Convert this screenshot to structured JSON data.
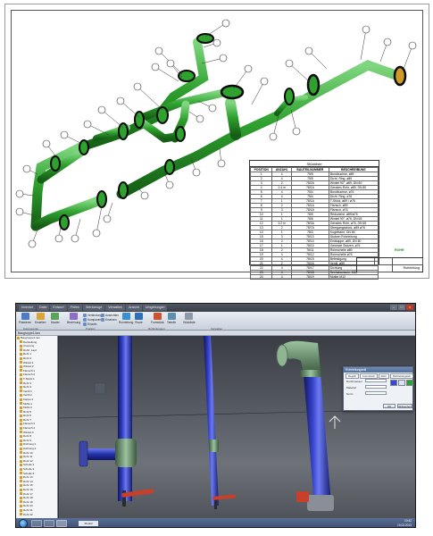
{
  "drawing": {
    "bom_title": "Stückliste",
    "bom_headers": [
      "POSITION",
      "ANZAHL",
      "BAUTEILNUMMER",
      "BESCHREIBUNG"
    ],
    "bom_rows": [
      [
        "1",
        "4",
        "75/5",
        "Bundbuchse, ø89"
      ],
      [
        "2",
        "4",
        "75/5",
        "Dicht. Ring, ø89"
      ],
      [
        "3",
        "2",
        "78/2A",
        "Winkel 90°, ø89, DN 80"
      ],
      [
        "4",
        "2.4 m",
        "78/1A",
        "Gerades Rohr, ø89, DN 80"
      ],
      [
        "5",
        "4",
        "75/4",
        "Bundbuchse, ø76"
      ],
      [
        "6",
        "4",
        "75/4",
        "Dicht. Ring, ø76"
      ],
      [
        "7",
        "1",
        "78/1A",
        "T-Stück, ø89 / ø76"
      ],
      [
        "8",
        "2",
        "78/1A",
        "Flansch, ø89"
      ],
      [
        "9",
        "3",
        "78/1A",
        "Flansch, ø76"
      ],
      [
        "10",
        "1",
        "78/5",
        "Reduzierst. ø89/ø76"
      ],
      [
        "11",
        "1",
        "78/6",
        "Winkel 90°, ø76, DN 65"
      ],
      [
        "12",
        "3.2 m",
        "78/3A",
        "Gerades Rohr, ø76, DN 65"
      ],
      [
        "13",
        "2",
        "78/7A",
        "Übergangsstück, ø89 ø76"
      ],
      [
        "14",
        "1",
        "78/3",
        "Kugelhahn, DN 65"
      ],
      [
        "15",
        "3",
        "78/13",
        "Stutzen Rohrleitung"
      ],
      [
        "16",
        "2",
        "78/14",
        "Endkappe, ø89, DN 80"
      ],
      [
        "17",
        "1",
        "78/10",
        "Gewinde Stutzen, ø76"
      ],
      [
        "18",
        "2",
        "78/11",
        "Rohrschelle ø89"
      ],
      [
        "19",
        "4",
        "78/12",
        "Rohrschelle ø76"
      ],
      [
        "20",
        "4",
        "78/15",
        "Befestigung"
      ],
      [
        "21",
        "2",
        "78/16",
        "Ventil, ø89"
      ],
      [
        "22",
        "4",
        "78/17",
        "Dichtung"
      ],
      [
        "23",
        "4",
        "78/18",
        "Sechskantschr. M12"
      ],
      [
        "24",
        "4",
        "78/19",
        "Mutter M12"
      ]
    ],
    "title_block_text": "Rohrleitung",
    "logo_text": "ROHR"
  },
  "app": {
    "title_tabs": [
      "Inventor",
      "Datei",
      "Entwurf",
      "Prüfen",
      "Werkzeuge",
      "Verwalten",
      "Ansicht",
      "Umgebungen"
    ],
    "ribbon": {
      "buttons": [
        {
          "label": "Platzieren",
          "color": "#4d7cc4"
        },
        {
          "label": "Erstellen",
          "color": "#d9a53a"
        },
        {
          "label": "Muster",
          "color": "#5aa35a"
        },
        {
          "label": "Beziehung",
          "color": "#8a6fc2"
        },
        {
          "label": "Rohrleitung",
          "color": "#3b8fd0"
        },
        {
          "label": "Route",
          "color": "#2f6fb5"
        },
        {
          "label": "Formstück",
          "color": "#c9542f"
        },
        {
          "label": "Tabelle",
          "color": "#5f8fb0"
        },
        {
          "label": "Stückliste",
          "color": "#8e9aa8"
        }
      ],
      "groups": [
        "Komponente",
        "Position",
        "Rohrleitungen",
        "Verwalten"
      ],
      "small_items": [
        "Verbindung",
        "Ausrichten",
        "Komponente",
        "Ersetzen",
        "Einzeln"
      ]
    },
    "doc_title": "Baugruppe1.iam",
    "browser_items": [
      "Baugruppe1.iam",
      "Darstellung",
      "Ursprung",
      "Rohrl. Lauf",
      "Rohr:1",
      "Rohr:2",
      "Winkel:1",
      "Winkel:2",
      "Flansch:1",
      "Flansch:2",
      "T-Stück:1",
      "Rohr:3",
      "Rohr:4",
      "Ventil:1",
      "Ventil:2",
      "Kappe:1",
      "Muffe:1",
      "Muffe:2",
      "Rohr:5",
      "Rohr:6",
      "Rohr:7",
      "Flansch:3",
      "Flansch:4",
      "Winkel:3",
      "Rohr:8",
      "Rohr:9",
      "Dichtung:1",
      "Dichtung:2",
      "Rohr:10",
      "Rohr:11",
      "Rohr:12",
      "Schelle:1",
      "Schelle:2",
      "Schelle:3",
      "Rohr:13",
      "Rohr:14",
      "Rohr:15",
      "Rohr:16",
      "Rohr:17",
      "Rohr:18",
      "Rohr:19",
      "Rohr:20",
      "Rohr:21",
      "Rohr:22"
    ],
    "dialog": {
      "title": "Rohrleitungsstil",
      "tabs": [
        "Regeln",
        "Formstück",
        "Rohr",
        "Rohrleitungsstil"
      ],
      "labels": [
        "Durchmesser",
        "Material",
        "Norm"
      ],
      "ok": "OK",
      "cancel": "Abbrechen"
    },
    "sheet_tab": "Modell",
    "clock_time": "10:42",
    "clock_date": "19.03.2013"
  },
  "colors": {
    "pipe_green": "#2fa12f",
    "pipe_blue": "#2430a8",
    "fitting_green": "#6c8f6f",
    "valve_red": "#c8402c"
  }
}
